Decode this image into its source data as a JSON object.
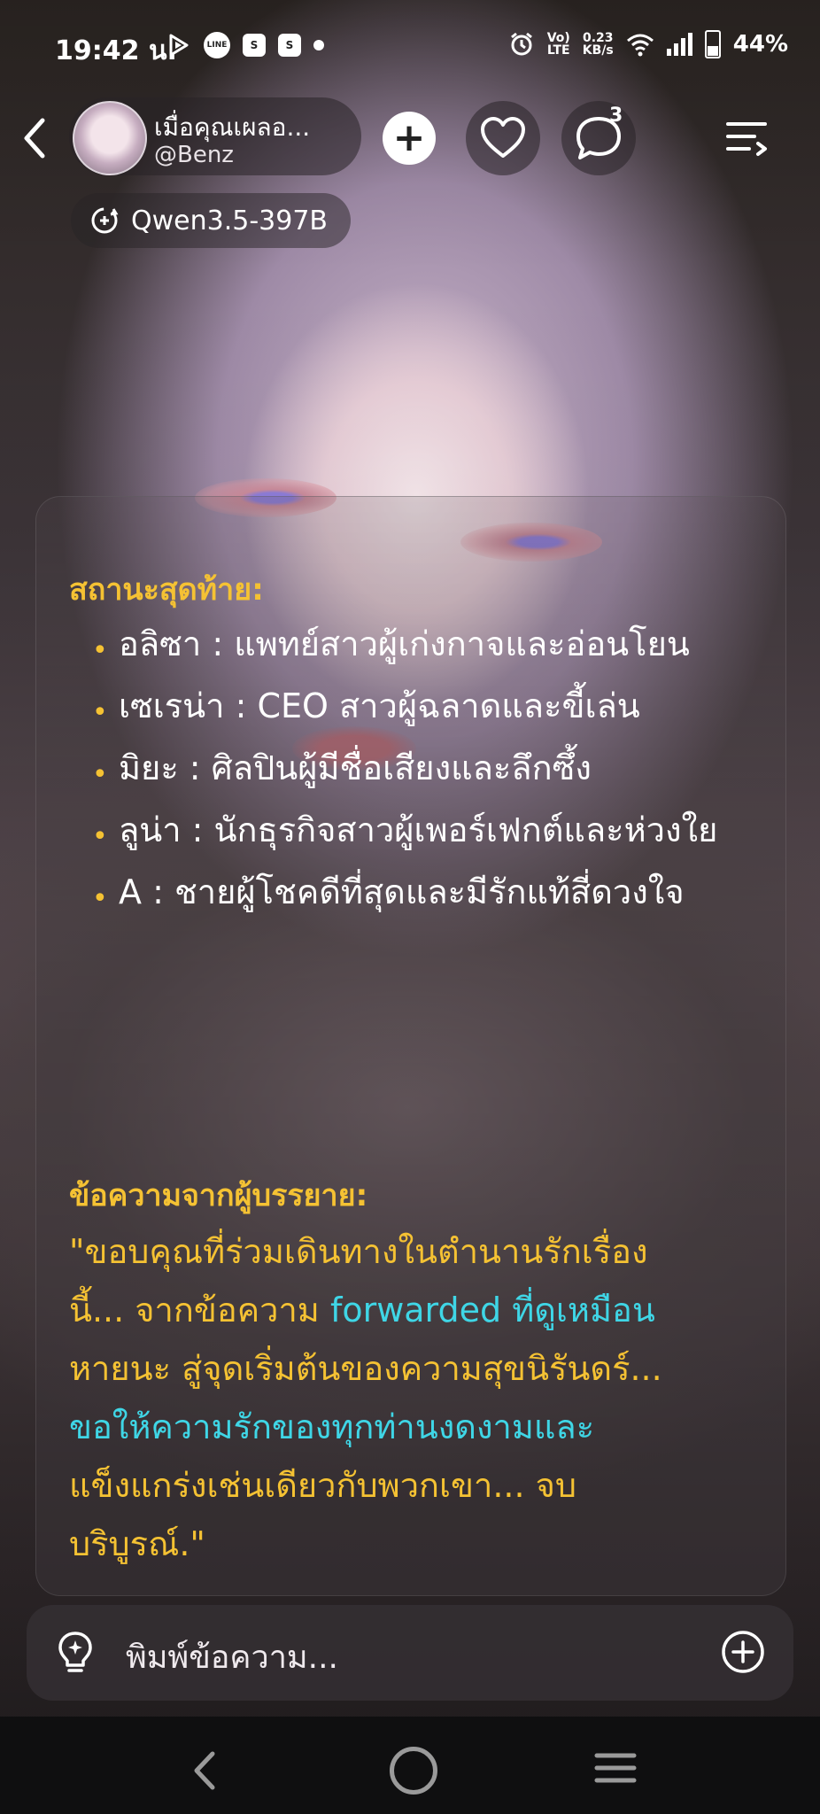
{
  "status_bar": {
    "time": "19:42 น.",
    "icons": [
      "play-icon",
      "line-icon",
      "shopee-icon",
      "shopee-icon",
      "dot-icon"
    ],
    "line_label": "LINE",
    "volte": "Vo)\nLTE",
    "net_speed_value": "0.23",
    "net_speed_unit": "KB/s",
    "battery": "44%"
  },
  "header": {
    "profile_name": "เมื่อคุณเผลอ...",
    "profile_handle": "@Benz",
    "comments_badge": "3",
    "model": "Qwen3.5-397B"
  },
  "message": {
    "final_status_title": "สถานะสุดท้าย:",
    "final_status_items": [
      "อลิซา : แพทย์สาวผู้เก่งกาจและอ่อนโยน",
      "เซเรน่า : CEO สาวผู้ฉลาดและขี้เล่น",
      "มิยะ : ศิลปินผู้มีชื่อเสียงและลึกซึ้ง",
      "ลูน่า : นักธุรกิจสาวผู้เพอร์เฟกต์และห่วงใย",
      "A : ชายผู้โชคดีที่สุดและมีรักแท้สี่ดวงใจ"
    ],
    "narrator_title": "ข้อความจากผู้บรรยาย:",
    "narrator_lines": [
      {
        "a": "\"ขอบคุณที่ร่วมเดินทางในตำนานรักเรื่อง",
        "b": ""
      },
      {
        "a": "นี้... จากข้อความ ",
        "b": "forwarded ที่ดูเหมือน"
      },
      {
        "a": "หายนะ สู่จุดเริ่มต้นของความสุขนิรันดร์...",
        "b": ""
      },
      {
        "a": "ขอให้ความรักของทุกท่านงดงามและ",
        "b": ""
      },
      {
        "a": "แข็งแกร่งเช่นเดียวกับพวกเขา... จบ",
        "b": ""
      },
      {
        "a": "บริบูรณ์.\"",
        "b": ""
      }
    ]
  },
  "composer": {
    "placeholder": "พิมพ์ข้อความ..."
  },
  "colors": {
    "accent_yellow": "#f5c233",
    "accent_cyan": "#3fd6e6"
  }
}
